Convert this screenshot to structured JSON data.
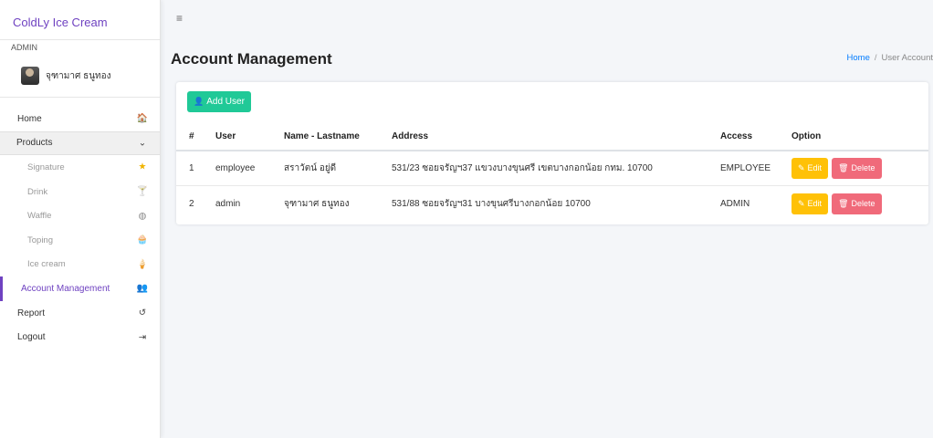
{
  "brand": {
    "name": "ColdLy Ice Cream"
  },
  "user": {
    "role": "ADMIN",
    "name": "จุฑามาศ ธนูทอง"
  },
  "sidebar": {
    "items": [
      {
        "label": "Home",
        "icon": "home-icon",
        "glyph": "🏠"
      },
      {
        "label": "Products",
        "icon": "chevron-down-icon",
        "glyph": "⌄"
      },
      {
        "label": "Signature",
        "icon": "star-icon",
        "glyph": "★"
      },
      {
        "label": "Drink",
        "icon": "cocktail-icon",
        "glyph": "🍸"
      },
      {
        "label": "Waffle",
        "icon": "waffle-icon",
        "glyph": "◍"
      },
      {
        "label": "Toping",
        "icon": "cupcake-icon",
        "glyph": "🧁"
      },
      {
        "label": "Ice cream",
        "icon": "ice-cream-icon",
        "glyph": "🍦"
      },
      {
        "label": "Account Management",
        "icon": "users-icon",
        "glyph": "👥"
      },
      {
        "label": "Report",
        "icon": "history-icon",
        "glyph": "↺"
      },
      {
        "label": "Logout",
        "icon": "sign-out-icon",
        "glyph": "⇥"
      }
    ]
  },
  "topbar": {
    "menu_icon": "hamburger-icon",
    "menu_glyph": "≡"
  },
  "page": {
    "title": "Account Management"
  },
  "breadcrumb": {
    "home": "Home",
    "separator": "/",
    "current": "User Account"
  },
  "actions": {
    "add_label": "Add User",
    "add_icon": "user-plus-icon",
    "add_glyph": "👤"
  },
  "table": {
    "headers": [
      "#",
      "User",
      "Name - Lastname",
      "Address",
      "Access",
      "Option"
    ],
    "rows": [
      {
        "num": "1",
        "user": "employee",
        "name": "สราวัตน์ อยู่ดี",
        "address": "531/23 ซอยจรัญฯ37 แขวงบางขุนศรี เขตบางกอกน้อย กทม. 10700",
        "access": "EMPLOYEE"
      },
      {
        "num": "2",
        "user": "admin",
        "name": "จุฑามาศ ธนูทอง",
        "address": "531/88 ซอยจรัญฯ31 บางขุนศรีบางกอกน้อย 10700",
        "access": "ADMIN"
      }
    ],
    "edit_label": "Edit",
    "edit_icon": "edit-icon",
    "edit_glyph": "✎",
    "delete_label": "Delete",
    "delete_icon": "trash-icon",
    "delete_glyph": "🗑"
  },
  "colors": {
    "accent": "#6f42c1",
    "add_button": "#20c997",
    "edit_button": "#ffc107",
    "delete_button": "#f06a7a",
    "link": "#007bff"
  }
}
